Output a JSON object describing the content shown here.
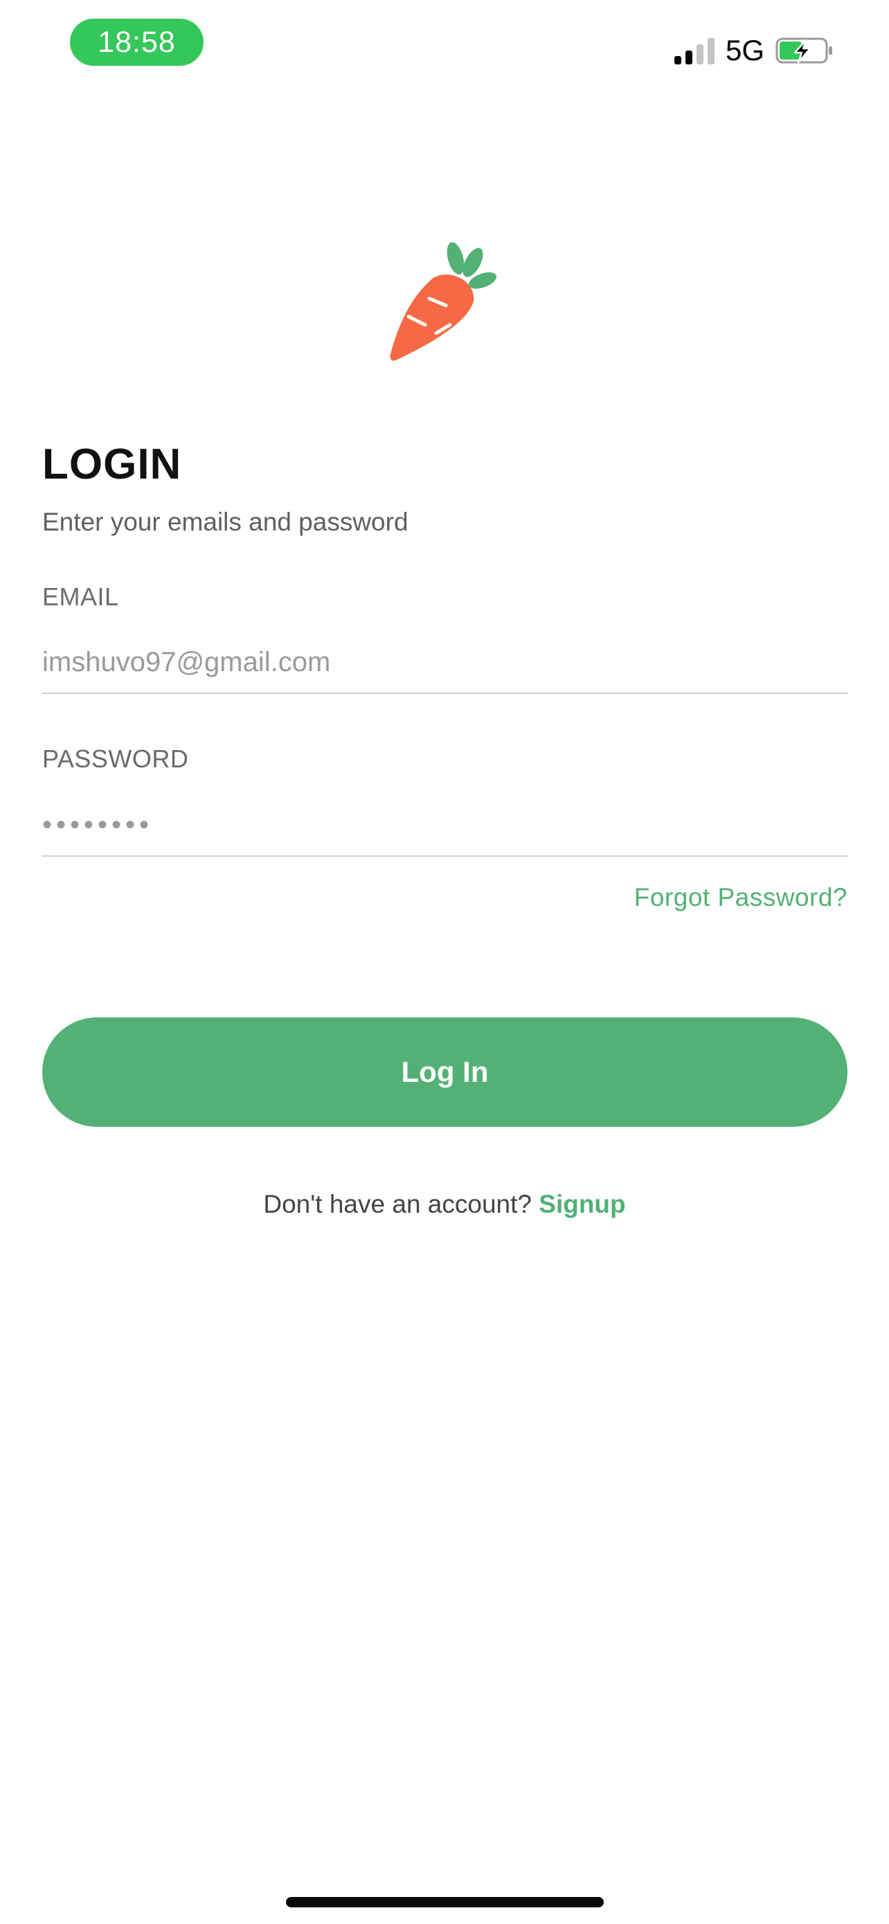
{
  "status_bar": {
    "time": "18:58",
    "network": "5G",
    "signal_bars_active": 2,
    "signal_bars_total": 4,
    "battery_charging": true
  },
  "logo": {
    "icon": "carrot-icon",
    "body_color": "#F56A45",
    "leaf_color": "#53B175"
  },
  "header": {
    "title": "LOGIN",
    "subtitle": "Enter your emails and password"
  },
  "form": {
    "email_label": "EMAIL",
    "email_value": "imshuvo97@gmail.com",
    "password_label": "PASSWORD",
    "password_value": "••••••••",
    "forgot_password": "Forgot Password?"
  },
  "actions": {
    "login_label": "Log In"
  },
  "signup_prompt": {
    "text": "Don't have an account?",
    "link": "Signup"
  },
  "colors": {
    "accent": "#53B175",
    "status_pill": "#34C759"
  }
}
